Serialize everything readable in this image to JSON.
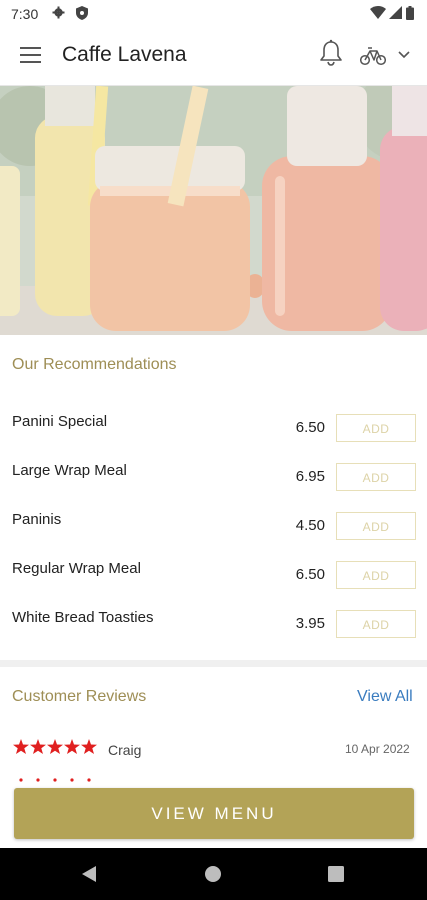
{
  "status_bar": {
    "time": "7:30"
  },
  "app_bar": {
    "title": "Caffe Lavena"
  },
  "recommendations": {
    "title": "Our Recommendations",
    "items": [
      {
        "name": "Panini Special",
        "price": "6.50",
        "add_label": "ADD"
      },
      {
        "name": "Large Wrap Meal",
        "price": "6.95",
        "add_label": "ADD"
      },
      {
        "name": "Paninis",
        "price": "4.50",
        "add_label": "ADD"
      },
      {
        "name": "Regular Wrap Meal",
        "price": "6.50",
        "add_label": "ADD"
      },
      {
        "name": "White Bread Toasties",
        "price": "3.95",
        "add_label": "ADD"
      }
    ]
  },
  "reviews": {
    "title": "Customer Reviews",
    "view_all": "View All",
    "items": [
      {
        "name": "Craig",
        "date": "10 Apr 2022",
        "rating": 5
      }
    ]
  },
  "view_menu_label": "VIEW MENU",
  "colors": {
    "accent": "#b3a357",
    "section_title": "#9e8e55",
    "link": "#3a7cbf",
    "star": "#e02020"
  }
}
